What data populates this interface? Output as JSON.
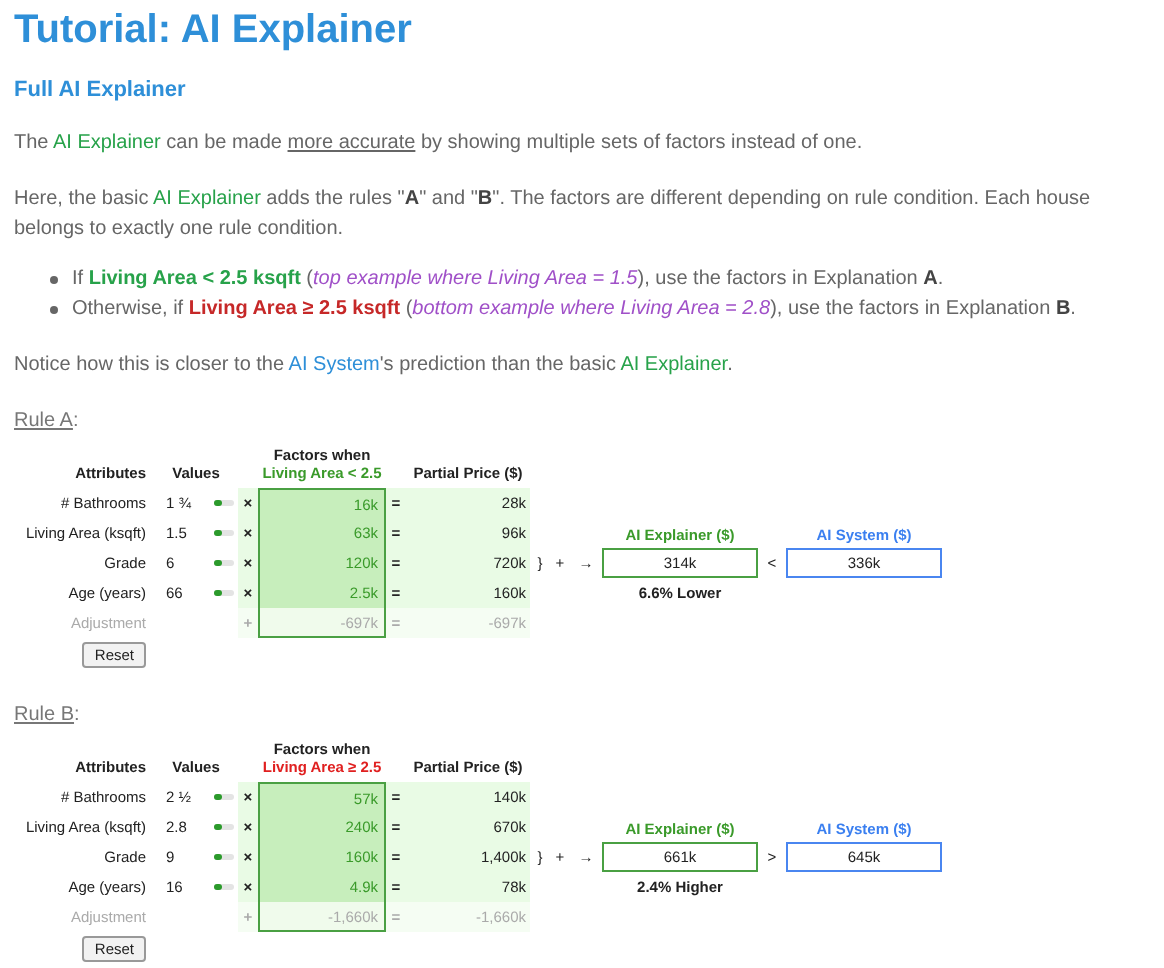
{
  "title": "Tutorial: AI Explainer",
  "subtitle": "Full AI Explainer",
  "paragraphs": [
    [
      {
        "kind": "plain",
        "text": "The "
      },
      {
        "kind": "green",
        "text": "AI Explainer"
      },
      {
        "kind": "plain",
        "text": " can be made "
      },
      {
        "kind": "underline",
        "text": "more accurate"
      },
      {
        "kind": "plain",
        "text": " by showing multiple sets of factors instead of one."
      }
    ],
    [
      {
        "kind": "plain",
        "text": "Here, the basic "
      },
      {
        "kind": "green",
        "text": "AI Explainer"
      },
      {
        "kind": "plain",
        "text": " adds the rules \""
      },
      {
        "kind": "bold",
        "text": "A"
      },
      {
        "kind": "plain",
        "text": "\" and \""
      },
      {
        "kind": "bold",
        "text": "B"
      },
      {
        "kind": "plain",
        "text": "\". The factors are different depending on rule condition. Each house belongs to exactly one rule condition."
      }
    ]
  ],
  "bullets": [
    [
      {
        "kind": "plain",
        "text": "If "
      },
      {
        "kind": "green-bold",
        "text": "Living Area < 2.5 ksqft"
      },
      {
        "kind": "plain",
        "text": " ("
      },
      {
        "kind": "purple-italic",
        "text": "top example where Living Area = 1.5"
      },
      {
        "kind": "plain",
        "text": "), use the factors in Explanation "
      },
      {
        "kind": "bold",
        "text": "A"
      },
      {
        "kind": "plain",
        "text": "."
      }
    ],
    [
      {
        "kind": "plain",
        "text": "Otherwise, if "
      },
      {
        "kind": "red-bold",
        "text": "Living Area ≥ 2.5 ksqft"
      },
      {
        "kind": "plain",
        "text": " ("
      },
      {
        "kind": "purple-italic",
        "text": "bottom example where Living Area = 2.8"
      },
      {
        "kind": "plain",
        "text": "), use the factors in Explanation "
      },
      {
        "kind": "bold",
        "text": "B"
      },
      {
        "kind": "plain",
        "text": "."
      }
    ]
  ],
  "note": [
    {
      "kind": "plain",
      "text": "Notice how this is closer to the "
    },
    {
      "kind": "blue",
      "text": "AI System"
    },
    {
      "kind": "plain",
      "text": "'s prediction than the basic "
    },
    {
      "kind": "green",
      "text": "AI Explainer"
    },
    {
      "kind": "plain",
      "text": "."
    }
  ],
  "rules": [
    {
      "heading": [
        {
          "kind": "underline",
          "text": "Rule A"
        },
        {
          "kind": "plain",
          "text": ":"
        }
      ],
      "color": "#3a9a2a",
      "headers": {
        "attributes": "Attributes",
        "values": "Values",
        "factors": "Factors when",
        "condition": "Living Area < 2.5",
        "partial": "Partial Price ($)"
      },
      "rows": [
        {
          "attribute": "# Bathrooms",
          "value": "1 ¾",
          "op": "×",
          "factor": "16k",
          "eq": "=",
          "partial": "28k"
        },
        {
          "attribute": "Living Area (ksqft)",
          "value": "1.5",
          "op": "×",
          "factor": "63k",
          "eq": "=",
          "partial": "96k"
        },
        {
          "attribute": "Grade",
          "value": "6",
          "op": "×",
          "factor": "120k",
          "eq": "=",
          "partial": "720k"
        },
        {
          "attribute": "Age (years)",
          "value": "66",
          "op": "×",
          "factor": "2.5k",
          "eq": "=",
          "partial": "160k"
        }
      ],
      "adjustment": {
        "label": "Adjustment",
        "op": "+",
        "factor": "-697k",
        "eq": "=",
        "partial": "-697k"
      },
      "brace": "}",
      "plus": "+",
      "arrow": "→",
      "explainer": {
        "header": "AI Explainer ($)",
        "value": "314k"
      },
      "comparison": "<",
      "system": {
        "header": "AI System ($)",
        "value": "336k"
      },
      "difference": "6.6% Lower",
      "reset": "Reset"
    },
    {
      "heading": [
        {
          "kind": "underline",
          "text": "Rule B"
        },
        {
          "kind": "plain",
          "text": ":"
        }
      ],
      "color": "#e02020",
      "headers": {
        "attributes": "Attributes",
        "values": "Values",
        "factors": "Factors when",
        "condition": "Living Area ≥ 2.5",
        "partial": "Partial Price ($)"
      },
      "rows": [
        {
          "attribute": "# Bathrooms",
          "value": "2 ½",
          "op": "×",
          "factor": "57k",
          "eq": "=",
          "partial": "140k"
        },
        {
          "attribute": "Living Area (ksqft)",
          "value": "2.8",
          "op": "×",
          "factor": "240k",
          "eq": "=",
          "partial": "670k"
        },
        {
          "attribute": "Grade",
          "value": "9",
          "op": "×",
          "factor": "160k",
          "eq": "=",
          "partial": "1,400k"
        },
        {
          "attribute": "Age (years)",
          "value": "16",
          "op": "×",
          "factor": "4.9k",
          "eq": "=",
          "partial": "78k"
        }
      ],
      "adjustment": {
        "label": "Adjustment",
        "op": "+",
        "factor": "-1,660k",
        "eq": "=",
        "partial": "-1,660k"
      },
      "brace": "}",
      "plus": "+",
      "arrow": "→",
      "explainer": {
        "header": "AI Explainer ($)",
        "value": "661k"
      },
      "comparison": ">",
      "system": {
        "header": "AI System ($)",
        "value": "645k"
      },
      "difference": "2.4% Higher",
      "reset": "Reset"
    }
  ]
}
